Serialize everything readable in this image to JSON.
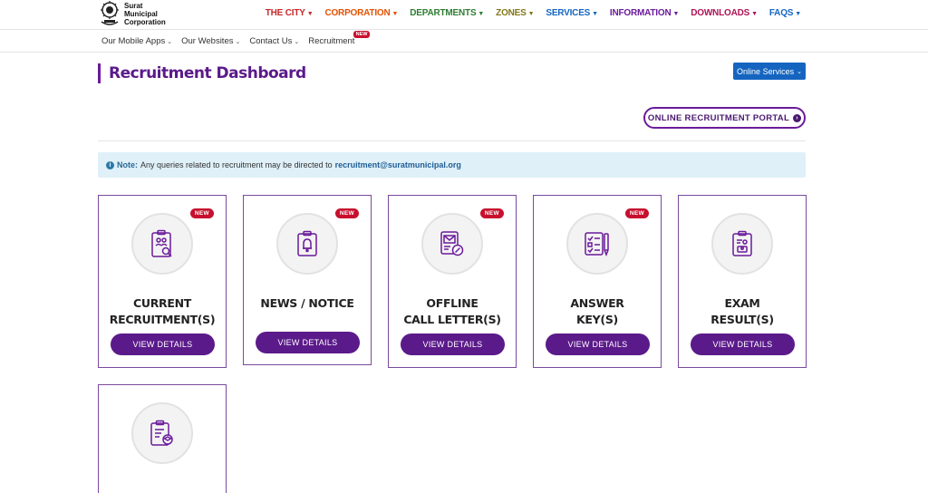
{
  "header": {
    "logo_lines": [
      "Surat",
      "Municipal",
      "Corporation"
    ],
    "main_nav": [
      {
        "label": "THE CITY",
        "color": "#c62828"
      },
      {
        "label": "CORPORATION",
        "color": "#e65100"
      },
      {
        "label": "DEPARTMENTS",
        "color": "#2e7d32"
      },
      {
        "label": "ZONES",
        "color": "#827717"
      },
      {
        "label": "SERVICES",
        "color": "#1565c0"
      },
      {
        "label": "INFORMATION",
        "color": "#6a1b9a"
      },
      {
        "label": "DOWNLOADS",
        "color": "#ad1457"
      },
      {
        "label": "FAQS",
        "color": "#1565c0"
      }
    ],
    "sub_nav": [
      "Our Mobile Apps",
      "Our Websites",
      "Contact Us",
      "Recruitment"
    ],
    "recruitment_badge": "NEW",
    "online_services": "Online Services"
  },
  "page": {
    "title": "Recruitment Dashboard",
    "portal_button": "ONLINE RECRUITMENT PORTAL",
    "note_label": "Note:",
    "note_text": "Any queries related to recruitment may be directed to",
    "note_email": "recruitment@suratmunicipal.org"
  },
  "cards": [
    {
      "lines": [
        "CURRENT",
        "RECRUITMENT(S)"
      ],
      "badge": "NEW",
      "button": "VIEW DETAILS",
      "icon": "clipboard-users-icon"
    },
    {
      "lines": [
        "NEWS / NOTICE"
      ],
      "badge": "NEW",
      "button": "VIEW DETAILS",
      "icon": "notice-bell-icon"
    },
    {
      "lines": [
        "OFFLINE",
        "CALL LETTER(S)"
      ],
      "badge": "NEW",
      "button": "VIEW DETAILS",
      "icon": "call-letter-icon"
    },
    {
      "lines": [
        "ANSWER",
        "KEY(S)"
      ],
      "badge": "NEW",
      "button": "VIEW DETAILS",
      "icon": "answer-key-icon"
    },
    {
      "lines": [
        "EXAM",
        "RESULT(S)"
      ],
      "badge": "",
      "button": "VIEW DETAILS",
      "icon": "exam-result-icon"
    },
    {
      "lines": [],
      "badge": "",
      "button": "",
      "icon": "certificate-icon"
    }
  ],
  "colors": {
    "accent_purple": "#5b1a8a",
    "badge_red": "#c8102e",
    "note_bg": "#dff0f8",
    "online_blue": "#1565c0"
  }
}
